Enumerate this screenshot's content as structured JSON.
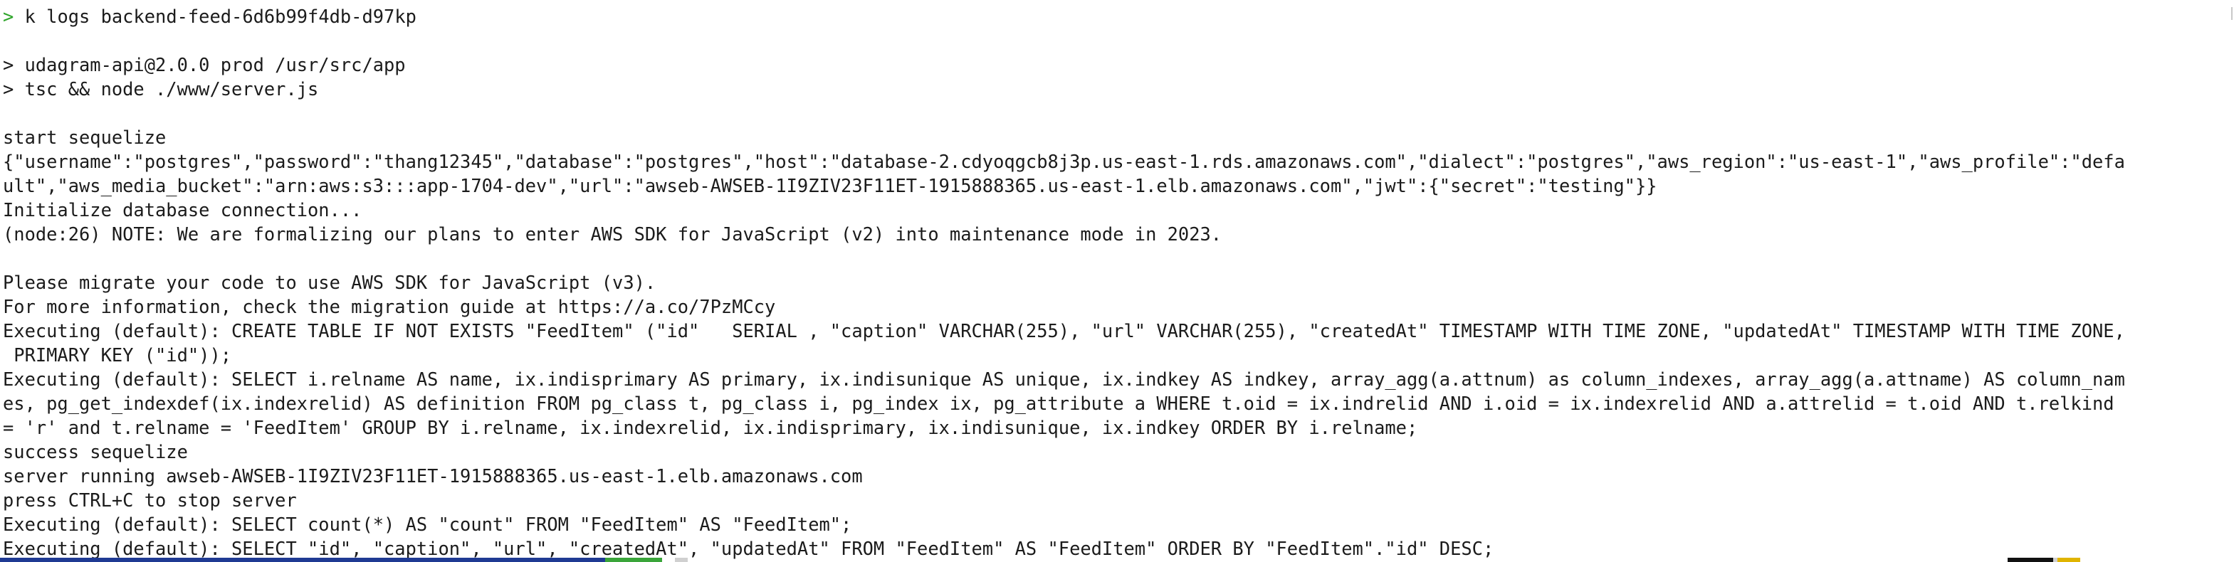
{
  "terminal": {
    "prompt_symbol": ">",
    "command": "k logs backend-feed-6d6b99f4db-d97kp",
    "lines": [
      "",
      "> udagram-api@2.0.0 prod /usr/src/app",
      "> tsc && node ./www/server.js",
      "",
      "start sequelize",
      "{\"username\":\"postgres\",\"password\":\"thang12345\",\"database\":\"postgres\",\"host\":\"database-2.cdyoqgcb8j3p.us-east-1.rds.amazonaws.com\",\"dialect\":\"postgres\",\"aws_region\":\"us-east-1\",\"aws_profile\":\"defa",
      "ult\",\"aws_media_bucket\":\"arn:aws:s3:::app-1704-dev\",\"url\":\"awseb-AWSEB-1I9ZIV23F11ET-1915888365.us-east-1.elb.amazonaws.com\",\"jwt\":{\"secret\":\"testing\"}}",
      "Initialize database connection...",
      "(node:26) NOTE: We are formalizing our plans to enter AWS SDK for JavaScript (v2) into maintenance mode in 2023.",
      "",
      "Please migrate your code to use AWS SDK for JavaScript (v3).",
      "For more information, check the migration guide at https://a.co/7PzMCcy",
      "Executing (default): CREATE TABLE IF NOT EXISTS \"FeedItem\" (\"id\"   SERIAL , \"caption\" VARCHAR(255), \"url\" VARCHAR(255), \"createdAt\" TIMESTAMP WITH TIME ZONE, \"updatedAt\" TIMESTAMP WITH TIME ZONE,",
      " PRIMARY KEY (\"id\"));",
      "Executing (default): SELECT i.relname AS name, ix.indisprimary AS primary, ix.indisunique AS unique, ix.indkey AS indkey, array_agg(a.attnum) as column_indexes, array_agg(a.attname) AS column_nam",
      "es, pg_get_indexdef(ix.indexrelid) AS definition FROM pg_class t, pg_class i, pg_index ix, pg_attribute a WHERE t.oid = ix.indrelid AND i.oid = ix.indexrelid AND a.attrelid = t.oid AND t.relkind",
      "= 'r' and t.relname = 'FeedItem' GROUP BY i.relname, ix.indexrelid, ix.indisprimary, ix.indisunique, ix.indkey ORDER BY i.relname;",
      "success sequelize",
      "server running awseb-AWSEB-1I9ZIV23F11ET-1915888365.us-east-1.elb.amazonaws.com",
      "press CTRL+C to stop server",
      "Executing (default): SELECT count(*) AS \"count\" FROM \"FeedItem\" AS \"FeedItem\";",
      "Executing (default): SELECT \"id\", \"caption\", \"url\", \"createdAt\", \"updatedAt\" FROM \"FeedItem\" AS \"FeedItem\" ORDER BY \"FeedItem\".\"id\" DESC;"
    ]
  },
  "colors": {
    "background": "#ffffff",
    "text": "#1b1b1b",
    "prompt_caret": "#2fa52b",
    "strip_blue": "#1f3a93",
    "strip_green": "#3aa53a",
    "strip_gray": "#d0d0d0",
    "strip_black": "#111111",
    "strip_yellow": "#e0b400"
  }
}
